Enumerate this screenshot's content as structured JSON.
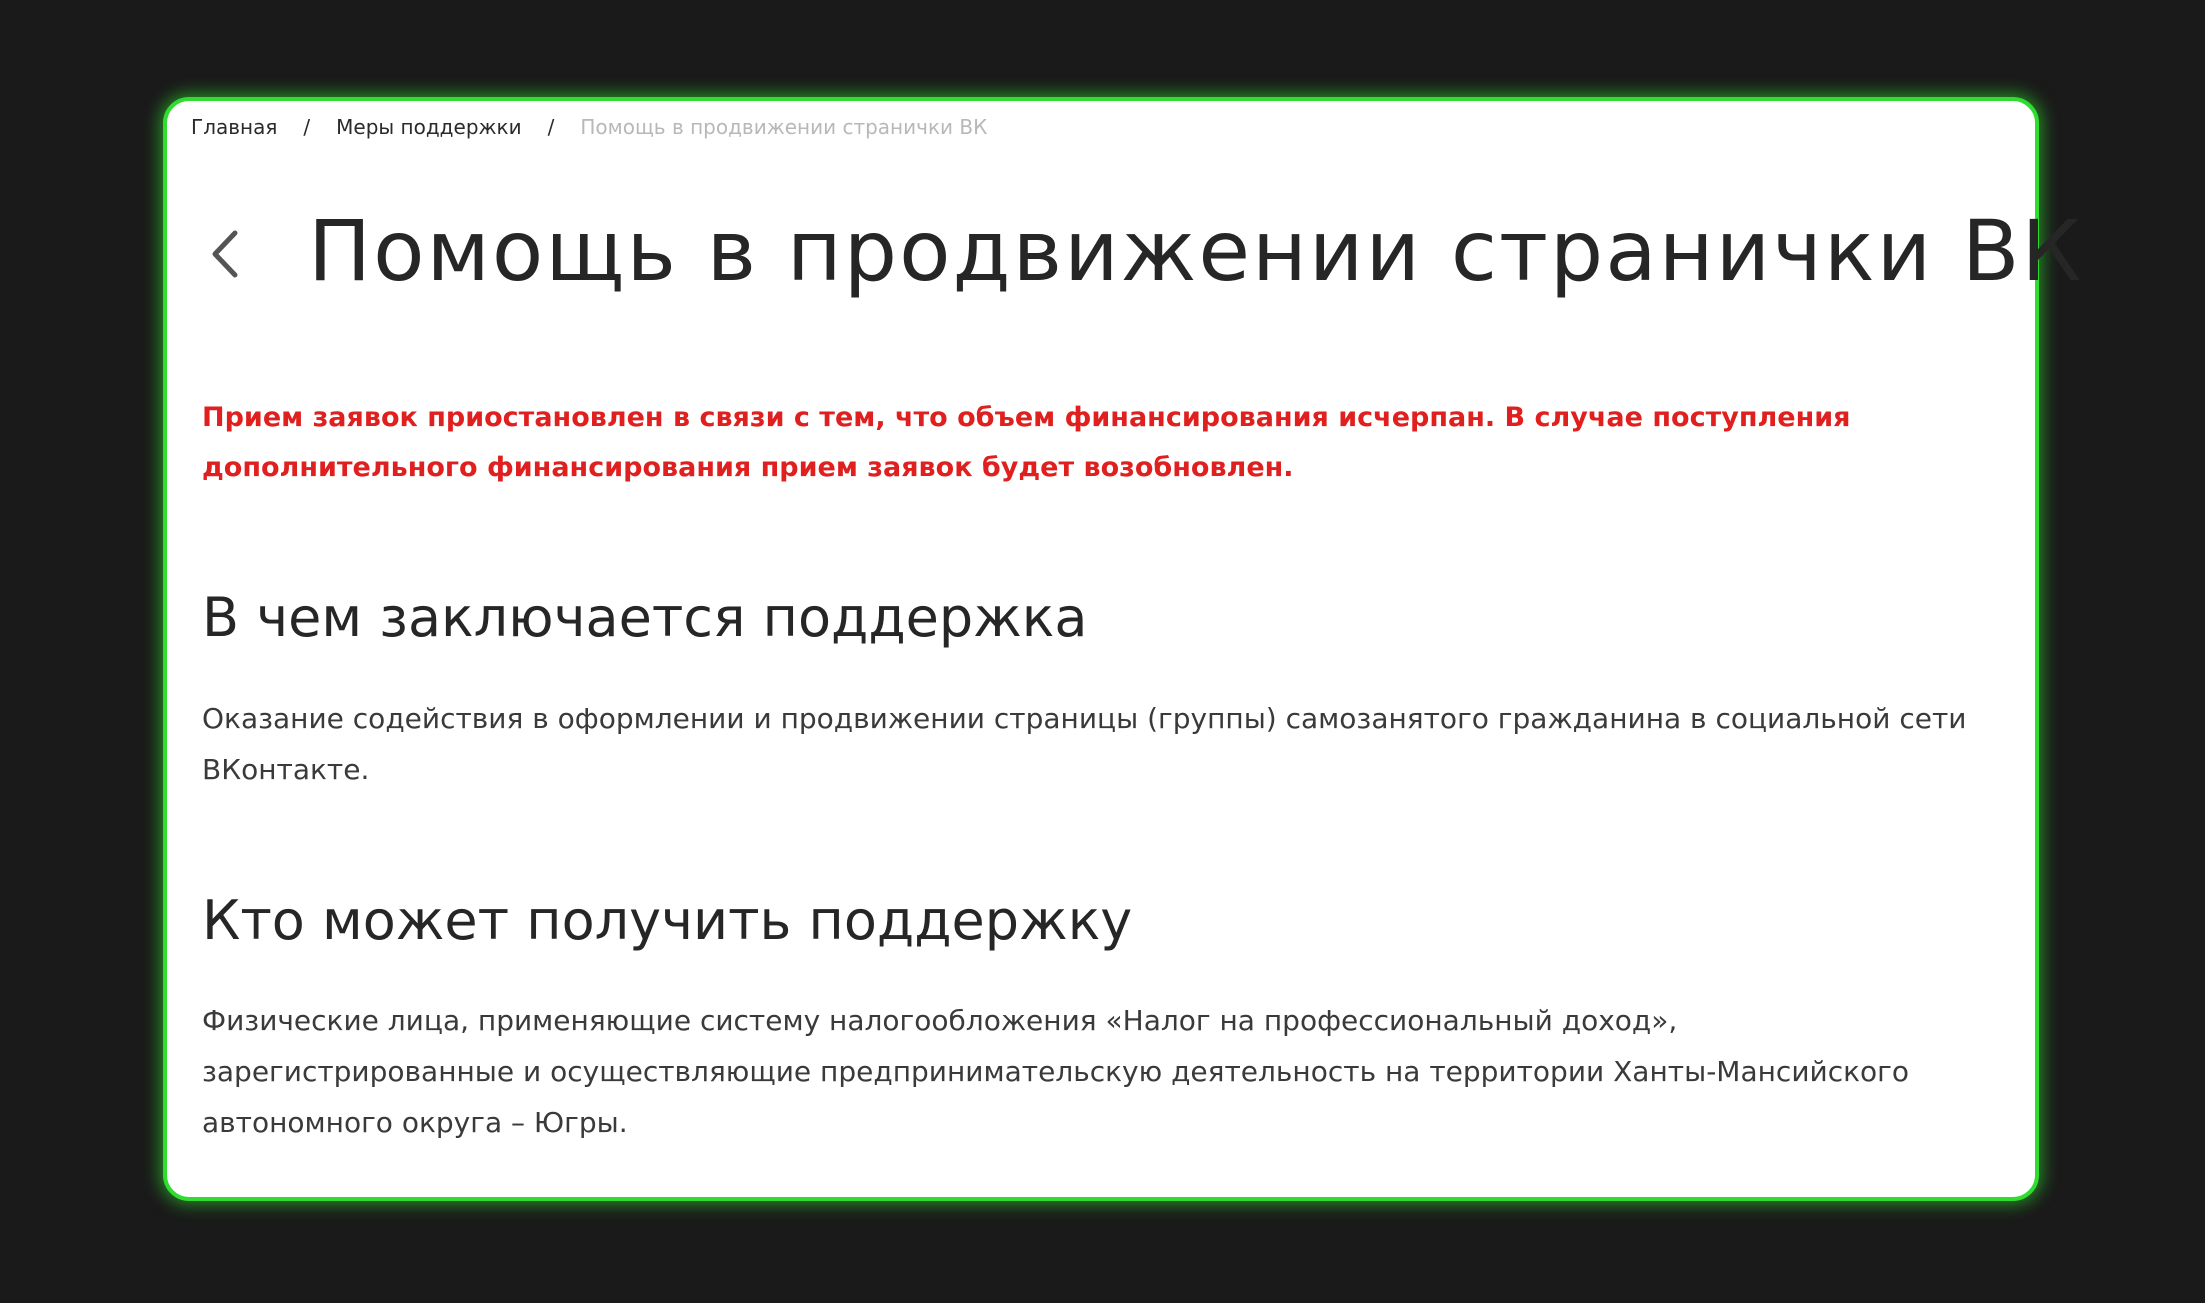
{
  "breadcrumb": {
    "home": "Главная",
    "separator": "/",
    "support_measures": "Меры поддержки",
    "current": "Помощь в продвижении странички ВК"
  },
  "back_icon": "chevron-left-icon",
  "page": {
    "title": "Помощь в продвижении странички ВК",
    "notice": "Прием заявок приостановлен в связи с тем, что объем финансирования исчерпан. В случае поступления дополнительного финансирования прием заявок будет возобновлен."
  },
  "sections": [
    {
      "title": "В чем заключается поддержка",
      "text": "Оказание содействия в оформлении и продвижении страницы (группы) самозанятого гражданина в социальной сети ВКонтакте."
    },
    {
      "title": "Кто может получить поддержку",
      "text": "Физические лица, применяющие систему налогообложения «Налог на профессиональный доход», зарегистрированные и осуществляющие предпринимательскую деятельность на территории Ханты-Мансийского автономного округа – Югры."
    }
  ],
  "colors": {
    "background": "#1a1a1a",
    "card": "#ffffff",
    "card_border_glow": "#2fdc2f",
    "notice": "#e01f1f",
    "breadcrumb_current": "#b8b8b8"
  }
}
